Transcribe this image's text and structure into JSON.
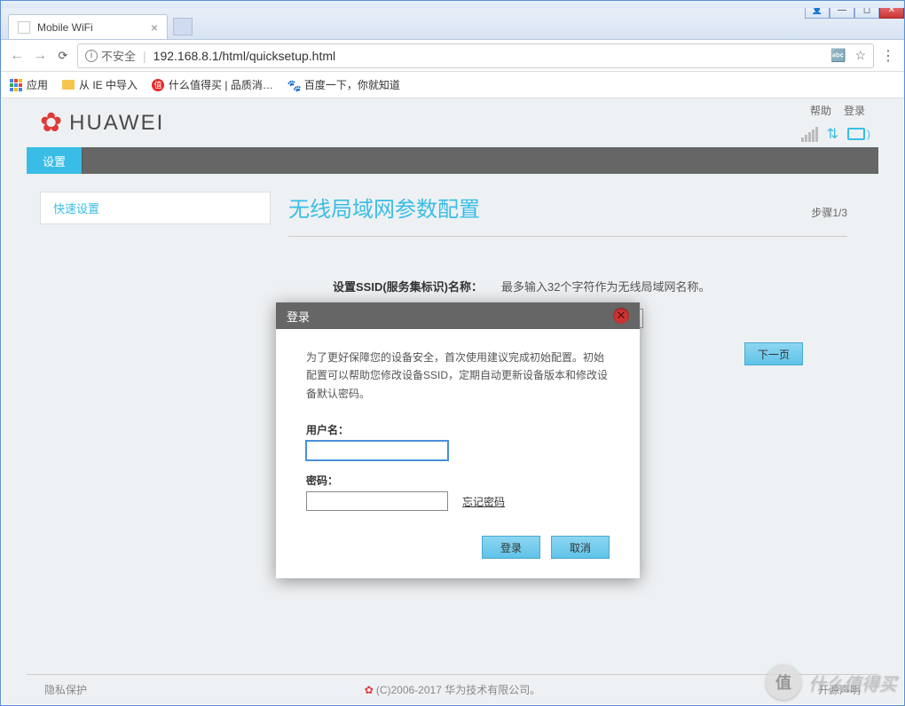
{
  "browser": {
    "tab_title": "Mobile WiFi",
    "insecure_label": "不安全",
    "url": "192.168.8.1/html/quicksetup.html"
  },
  "bookmarks": {
    "apps": "应用",
    "ie_import": "从 IE 中导入",
    "smzdm": "什么值得买 | 品质消…",
    "baidu": "百度一下，你就知道"
  },
  "header": {
    "brand": "HUAWEI",
    "help": "帮助",
    "login": "登录"
  },
  "nav": {
    "settings": "设置"
  },
  "sidebar": {
    "quick_setup": "快速设置"
  },
  "main": {
    "title": "无线局域网参数配置",
    "step": "步骤1/3",
    "ssid_label": "设置SSID(服务集标识)名称：",
    "ssid_desc": "最多输入32个字符作为无线局域网名称。",
    "next": "下一页"
  },
  "modal": {
    "title": "登录",
    "message": "为了更好保障您的设备安全，首次使用建议完成初始配置。初始配置可以帮助您修改设备SSID，定期自动更新设备版本和修改设备默认密码。",
    "username_label": "用户名：",
    "password_label": "密码：",
    "forgot": "忘记密码",
    "login_btn": "登录",
    "cancel_btn": "取消"
  },
  "footer": {
    "privacy": "隐私保护",
    "copyright": "(C)2006-2017 华为技术有限公司。",
    "opensource": "开源声明"
  },
  "watermark": {
    "badge": "值",
    "text": "什么值得买"
  }
}
